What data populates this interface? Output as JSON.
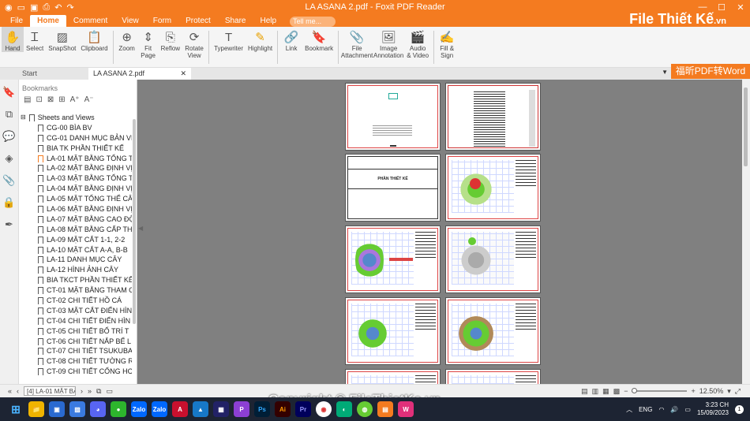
{
  "window": {
    "title": "LA ASANA 2.pdf - Foxit PDF Reader"
  },
  "menu": {
    "items": [
      "File",
      "Home",
      "Comment",
      "View",
      "Form",
      "Protect",
      "Share",
      "Help"
    ],
    "tell_me": "Tell me..."
  },
  "logo": {
    "text": "File Thiết Kế",
    "suffix": ".vn"
  },
  "ribbon": {
    "buttons": [
      {
        "label": "Hand",
        "icon": "hand-icon"
      },
      {
        "label": "Select",
        "icon": "select-icon"
      },
      {
        "label": "SnapShot",
        "icon": "snapshot-icon"
      },
      {
        "label": "Clipboard",
        "icon": "clipboard-icon"
      },
      {
        "label": "Zoom",
        "icon": "zoom-icon"
      },
      {
        "label": "Fit Page",
        "icon": "fit-page-icon"
      },
      {
        "label": "Reflow",
        "icon": "reflow-icon"
      },
      {
        "label": "Rotate View",
        "icon": "rotate-icon"
      },
      {
        "label": "Typewriter",
        "icon": "typewriter-icon"
      },
      {
        "label": "Highlight",
        "icon": "highlight-icon"
      },
      {
        "label": "Link",
        "icon": "link-icon"
      },
      {
        "label": "Bookmark",
        "icon": "bookmark-icon"
      },
      {
        "label": "File Attachment",
        "icon": "file-attachment-icon"
      },
      {
        "label": "Image Annotation",
        "icon": "image-annotation-icon"
      },
      {
        "label": "Audio & Video",
        "icon": "audio-video-icon"
      },
      {
        "label": "Fill & Sign",
        "icon": "fill-sign-icon"
      }
    ]
  },
  "tabs": {
    "start": "Start",
    "doc": "LA ASANA 2.pdf"
  },
  "banner": {
    "text": "福昕PDF转Word"
  },
  "bookmarks": {
    "header": "Bookmarks",
    "root": "Sheets and Views",
    "items": [
      "CG-00 BÌA BV",
      "CG-01 DANH MỤC BẢN VẼ",
      "BIA TK PHẦN THIẾT KẾ",
      "LA-01 MẶT BẰNG TỔNG T",
      "LA-02 MẶT BẰNG ĐỊNH VỊ",
      "LA-03 MẶT BẰNG TỔNG T",
      "LA-04 MẶT BẰNG ĐỊNH VỊ",
      "LA-05 MẶT TỔNG THỂ CÂY",
      "LA-06 MẶT BẰNG ĐỊNH VỊ",
      "LA-07 MẶT BẰNG CAO ĐỘ",
      "LA-08 MẶT BẰNG CẤP THO",
      "LA-09 MẶT CẮT 1-1, 2-2",
      "LA-10 MẶT CẮT A-A, B-B",
      "LA-11 DANH MỤC CÂY",
      "LA-12 HÌNH ẢNH CÂY",
      "BIA TKCT PHẦN THIẾT KẾ",
      "CT-01 MẶT BẰNG THAM C",
      "CT-02 CHI TIẾT HỒ CÁ",
      "CT-03 MẶT CẮT ĐIỂN HÌN",
      "CT-04 CHI TIẾT ĐIỂN HÌN",
      "CT-05 CHI TIẾT BỐ TRÍ T",
      "CT-06 CHI TIẾT NẮP BỂ L",
      "CT-07 CHI TIẾT TSUKUBA",
      "CT-08 CHI TIẾT TƯỜNG R",
      "CT-09 CHI TIẾT CỔNG HC"
    ]
  },
  "cover_page": {
    "title": "PHẦN THIẾT KẾ"
  },
  "status": {
    "page": "[4] LA-01 MẶT BẰ",
    "zoom": "12.50%"
  },
  "watermark": {
    "text": "Copyright © FileThietKe.vn"
  },
  "taskbar": {
    "lang": "ENG",
    "time": "3:23 CH",
    "date": "15/09/2023"
  }
}
